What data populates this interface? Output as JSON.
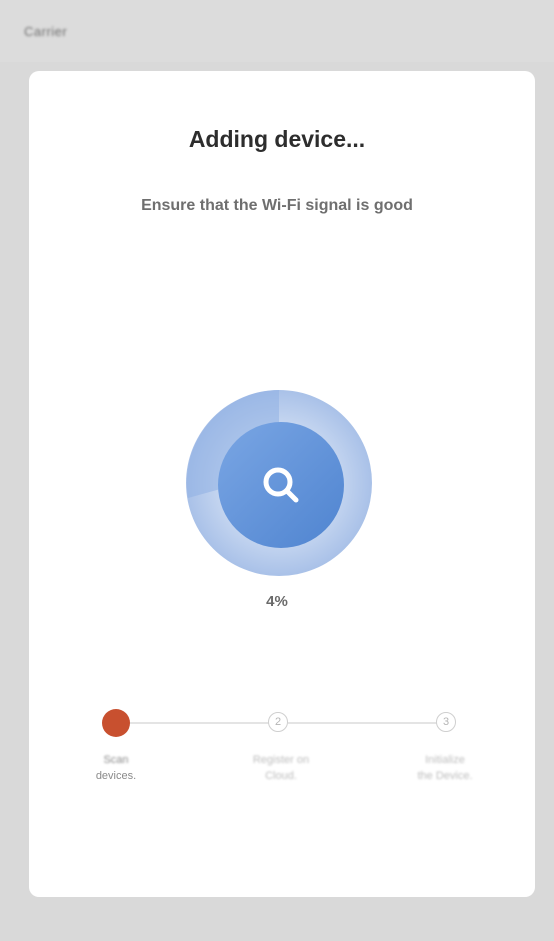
{
  "status_bar": {
    "carrier": "Carrier"
  },
  "main": {
    "title": "Adding device...",
    "subtitle": "Ensure that the Wi-Fi signal is good",
    "progress_percent": "4%",
    "progress_value": 0.04,
    "search_icon": "search-icon"
  },
  "steps": [
    {
      "label_line1": "Scan",
      "label_line2": "devices.",
      "state": "active",
      "number": ""
    },
    {
      "label_line1": "Register on",
      "label_line2": "Cloud.",
      "state": "pending",
      "number": "2"
    },
    {
      "label_line1": "Initialize",
      "label_line2": "the Device.",
      "state": "pending",
      "number": "3"
    }
  ],
  "colors": {
    "accent": "#c8502f",
    "ring_outer": "#b9cdeb",
    "ring_inner": "#5c8fd6",
    "background": "#d9d9d9"
  }
}
